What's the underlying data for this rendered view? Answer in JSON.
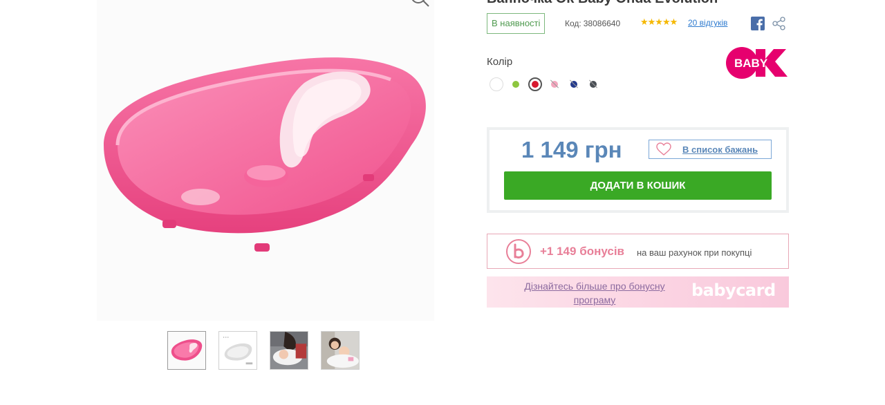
{
  "product": {
    "title": "Ванночка Ok Baby Onda Evolution",
    "stock_status": "В наявності",
    "code_label": "Код:",
    "code_value": "38086640",
    "rating_stars": "★★★★★",
    "rating": 5,
    "reviews_link": "20 відгуків"
  },
  "icons": {
    "zoom": "zoom-in-icon",
    "facebook": "facebook-icon",
    "share": "share-icon",
    "heart": "heart-icon",
    "bonus": "bonus-b-icon"
  },
  "color_section": {
    "label": "Колір",
    "swatches": [
      {
        "name": "white",
        "color": "#ffffff",
        "available": true
      },
      {
        "name": "green",
        "color": "#8dc63f",
        "available": true
      },
      {
        "name": "red",
        "color": "#d7192f",
        "available": true,
        "selected": true
      },
      {
        "name": "pink",
        "color": "#f3a6bd",
        "available": false
      },
      {
        "name": "navy",
        "color": "#243a8c",
        "available": false
      },
      {
        "name": "grey",
        "color": "#4a4f55",
        "available": false
      }
    ]
  },
  "brand": {
    "logo_text": "BABY",
    "logo_color": "#e6006e"
  },
  "pricing": {
    "price": "1 149 грн",
    "wishlist_label": "В список бажань",
    "add_to_cart": "ДОДАТИ В КОШИК",
    "accent_color": "#3aa925"
  },
  "bonus": {
    "amount": "+1 149 бонусів",
    "description": "на ваш рахунок при покупці"
  },
  "promo": {
    "link_text": "Дізнайтесь більше про бонусну програму",
    "logo_text": "babycard"
  }
}
